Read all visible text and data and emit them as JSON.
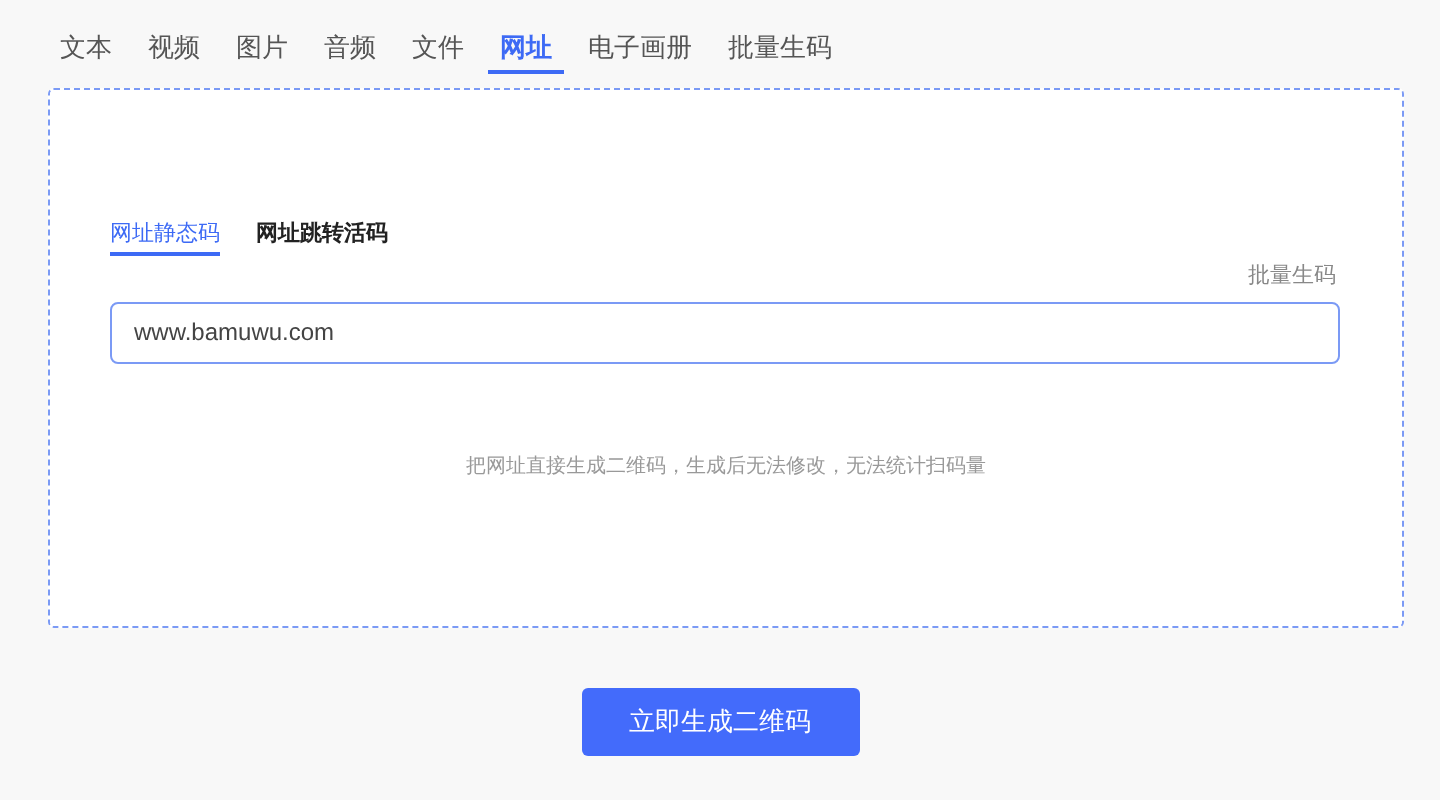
{
  "tabs": [
    {
      "label": "文本",
      "selected": false
    },
    {
      "label": "视频",
      "selected": false
    },
    {
      "label": "图片",
      "selected": false
    },
    {
      "label": "音频",
      "selected": false
    },
    {
      "label": "文件",
      "selected": false
    },
    {
      "label": "网址",
      "selected": true
    },
    {
      "label": "电子画册",
      "selected": false
    },
    {
      "label": "批量生码",
      "selected": false
    }
  ],
  "sub_tabs": [
    {
      "label": "网址静态码",
      "selected": true
    },
    {
      "label": "网址跳转活码",
      "selected": false
    }
  ],
  "batch_link": "批量生码",
  "url_field": {
    "value": "www.bamuwu.com"
  },
  "hint": "把网址直接生成二维码，生成后无法修改，无法统计扫码量",
  "generate_button": "立即生成二维码"
}
